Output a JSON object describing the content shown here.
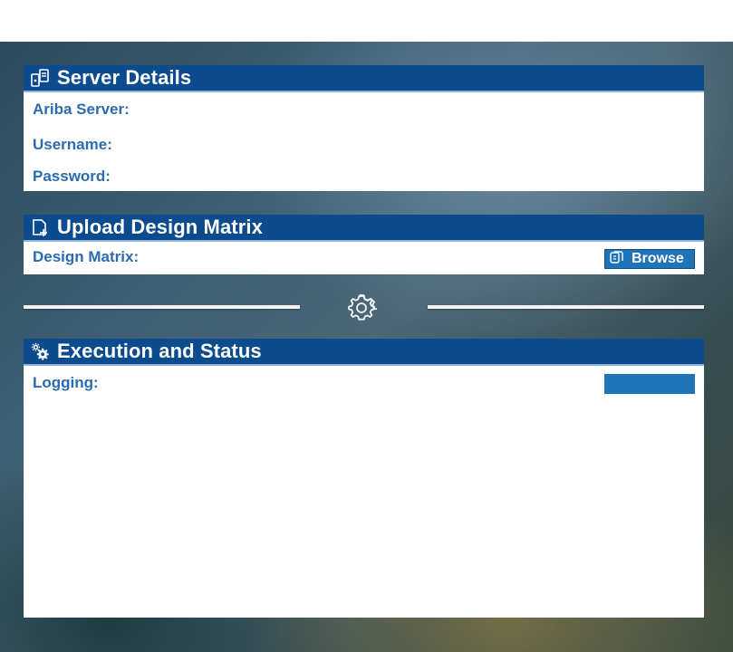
{
  "server_details": {
    "title": "Server Details",
    "icon": "server-icon",
    "fields": {
      "ariba_server_label": "Ariba Server:",
      "username_label": "Username:",
      "password_label": "Password:"
    }
  },
  "upload": {
    "title": "Upload Design Matrix",
    "icon": "file-add-icon",
    "design_matrix_label": "Design Matrix:",
    "browse_label": "Browse",
    "browse_icon": "browse-icon"
  },
  "separator": {
    "icon": "gear-icon"
  },
  "execution": {
    "title": "Execution and Status",
    "icon": "gears-icon",
    "logging_label": "Logging:"
  },
  "colors": {
    "header_bg": "#0b4b8e",
    "label_text": "#2b6cb0",
    "button_bg": "#1f73b7"
  }
}
